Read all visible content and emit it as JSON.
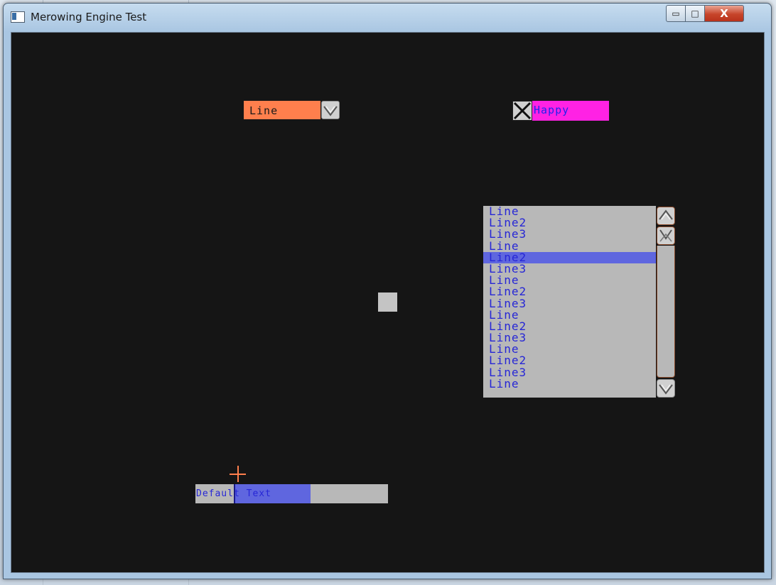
{
  "window": {
    "title": "Merowing Engine Test"
  },
  "window_controls": {
    "minimize": "▭",
    "maximize": "□",
    "close": "X"
  },
  "combo": {
    "value": "Line"
  },
  "checkbox": {
    "checked": true,
    "label": "Happy"
  },
  "listbox": {
    "items": [
      "Line",
      "Line2",
      "Line3",
      "Line",
      "Line2",
      "Line3",
      "Line",
      "Line2",
      "Line3",
      "Line",
      "Line2",
      "Line3",
      "Line",
      "Line2",
      "Line3",
      "Line"
    ],
    "selected_index": 4
  },
  "textbox": {
    "value": "Default Text"
  },
  "colors": {
    "combo_bg": "#ff7f4d",
    "checkbox_label_bg": "#ff22e4",
    "list_text": "#2626d6",
    "selection": "#5f66df",
    "client_bg": "#151515"
  }
}
